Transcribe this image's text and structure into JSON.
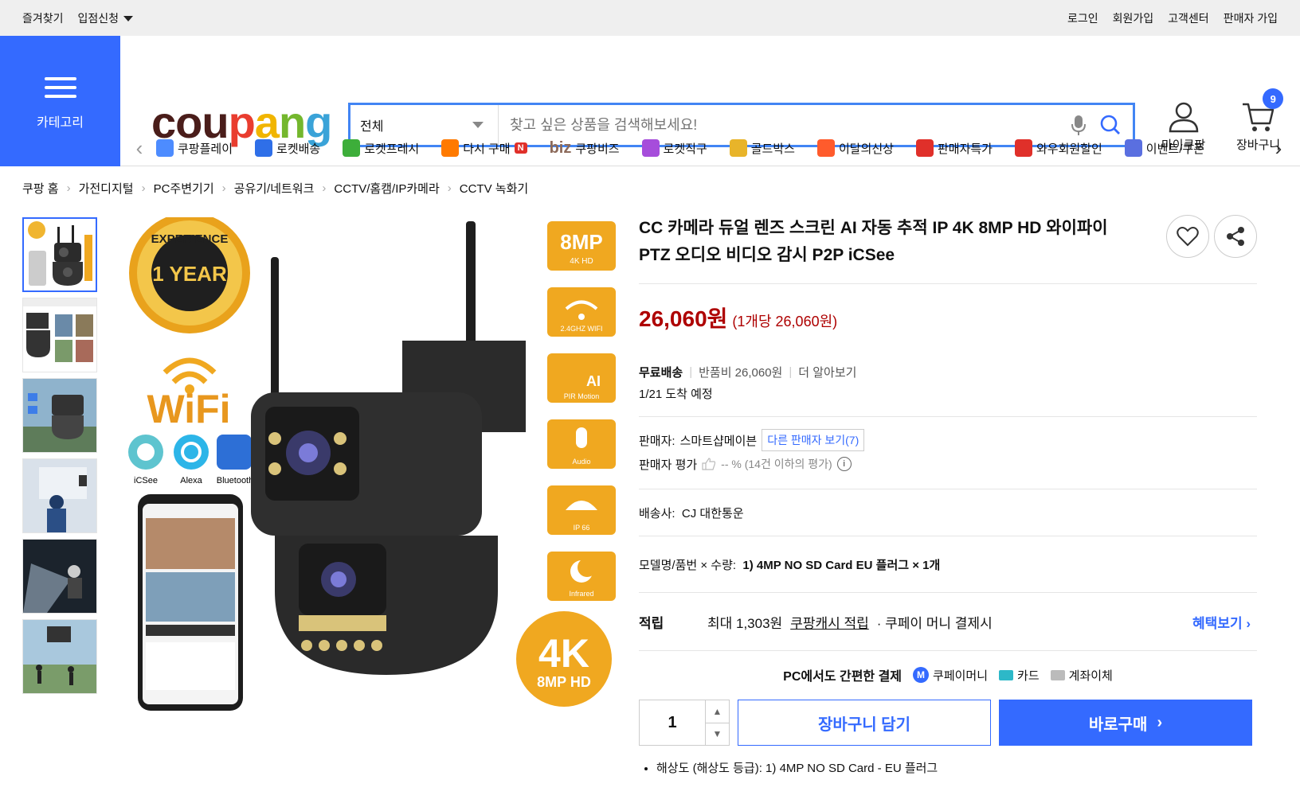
{
  "topbar": {
    "left": [
      "즐겨찾기",
      "입점신청"
    ],
    "right": [
      "로그인",
      "회원가입",
      "고객센터",
      "판매자 가입"
    ]
  },
  "header": {
    "category_label": "카테고리",
    "logo": {
      "c1": "cou",
      "c2": "p",
      "c3": "a",
      "c4": "n",
      "c5": "g"
    },
    "search": {
      "category": "전체",
      "placeholder": "찾고 싶은 상품을 검색해보세요!"
    },
    "mycoupang": "마이쿠팡",
    "cart": "장바구니",
    "cart_count": "9"
  },
  "nav": {
    "items": [
      {
        "label": "쿠팡플레이",
        "color": "#4d8cff"
      },
      {
        "label": "로켓배송",
        "color": "#2f6fe8"
      },
      {
        "label": "로켓프레시",
        "color": "#3dae3a"
      },
      {
        "label": "다시 구매",
        "color": "#ff7a00"
      },
      {
        "label": "쿠팡비즈",
        "prefix": "biz",
        "color": "#8c6a5a"
      },
      {
        "label": "로켓직구",
        "color": "#a64ddb"
      },
      {
        "label": "골드박스",
        "color": "#e8b42a"
      },
      {
        "label": "이달의신상",
        "color": "#ff5b2c"
      },
      {
        "label": "판매자특가",
        "color": "#e0302a"
      },
      {
        "label": "와우회원할인",
        "color": "#e0302a"
      },
      {
        "label": "이벤트/쿠폰",
        "color": "#5a6fe0"
      }
    ],
    "new_badge": "N"
  },
  "breadcrumb": [
    "쿠팡 홈",
    "가전디지털",
    "PC주변기기",
    "공유기/네트워크",
    "CCTV/홈캠/IP카메라",
    "CCTV 녹화기"
  ],
  "product": {
    "title": "CC 카메라 듀얼 렌즈 스크린 AI 자동 추적 IP 4K 8MP HD 와이파이 PTZ 오디오 비디오 감시 P2P iCSee",
    "price": "26,060원",
    "unit_price": "(1개당 26,060원)",
    "shipping": {
      "free": "무료배송",
      "return_fee": "반품비 26,060원",
      "more": "더 알아보기",
      "arrival": "1/21 도착 예정"
    },
    "seller": {
      "label": "판매자:",
      "name": "스마트샵메이븐",
      "other": "다른 판매자 보기(7)",
      "rating_label": "판매자 평가",
      "rating": "-- % (14건 이하의 평가)"
    },
    "carrier": {
      "label": "배송사:",
      "value": "CJ 대한통운"
    },
    "option": {
      "label": "모델명/품번 × 수량:",
      "value": "1) 4MP NO SD Card EU 플러그 × 1개"
    },
    "reward": {
      "label": "적립",
      "max": "최대 1,303원",
      "link": "쿠팡캐시 적립",
      "suffix": "· 쿠페이 머니 결제시",
      "more": "혜택보기"
    },
    "pay": {
      "title": "PC에서도 간편한 결제",
      "methods": [
        "쿠페이머니",
        "카드",
        "계좌이체"
      ]
    },
    "qty": "1",
    "cart_button": "장바구니 담기",
    "buy_button": "바로구매",
    "spec": "해상도 (해상도 등급): 1) 4MP NO SD Card - EU 플러그"
  },
  "image_text": {
    "badge1": "1 YEAR",
    "badge_ring": "EXPERIENCE",
    "wifi": "WiFi",
    "icsee": "iCSee",
    "alexa": "Alexa",
    "bluetooth": "Bluetooth",
    "f1": "8MP",
    "f1s": "4K HD",
    "f2s": "2.4GHZ WIFI",
    "f3": "AI",
    "f3s": "PIR Motion",
    "f4s": "Audio",
    "f5s": "IP 66",
    "f6s": "Infrared",
    "k4": "4K",
    "k4s": "8MP HD"
  }
}
